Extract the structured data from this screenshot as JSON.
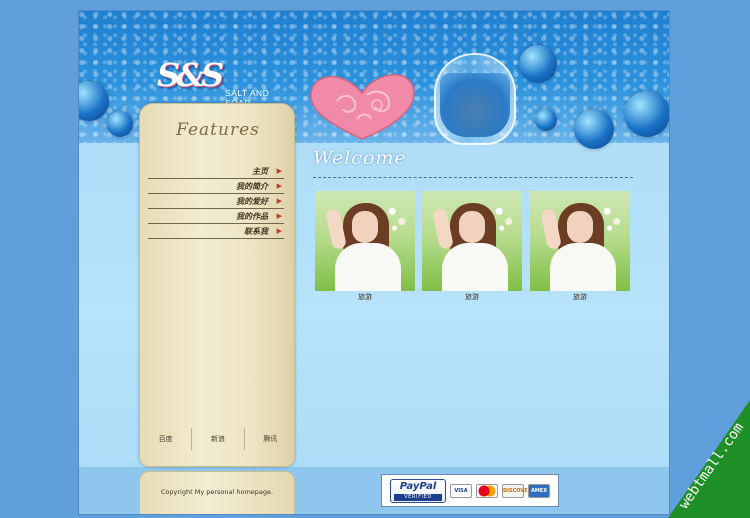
{
  "header": {
    "logo_mark": "S&S",
    "brand": "SALT AND SOAP"
  },
  "sidebar": {
    "title": "Features",
    "nav": [
      {
        "label": "主页"
      },
      {
        "label": "我的简介"
      },
      {
        "label": "我的爱好"
      },
      {
        "label": "我的作品"
      },
      {
        "label": "联系我"
      }
    ],
    "links": [
      "百度",
      "新浪",
      "腾讯"
    ],
    "copyright": "Copyright My personal homepage."
  },
  "main": {
    "heading": "Welcome",
    "gallery": [
      {
        "caption": "旅游"
      },
      {
        "caption": "旅游"
      },
      {
        "caption": "旅游"
      }
    ]
  },
  "payment": {
    "paypal": "PayPal",
    "verified": "VERIFIED",
    "cards": [
      "VISA",
      "MasterCard",
      "DISCOVER",
      "AMEX"
    ]
  },
  "watermark": "webtmall.com"
}
